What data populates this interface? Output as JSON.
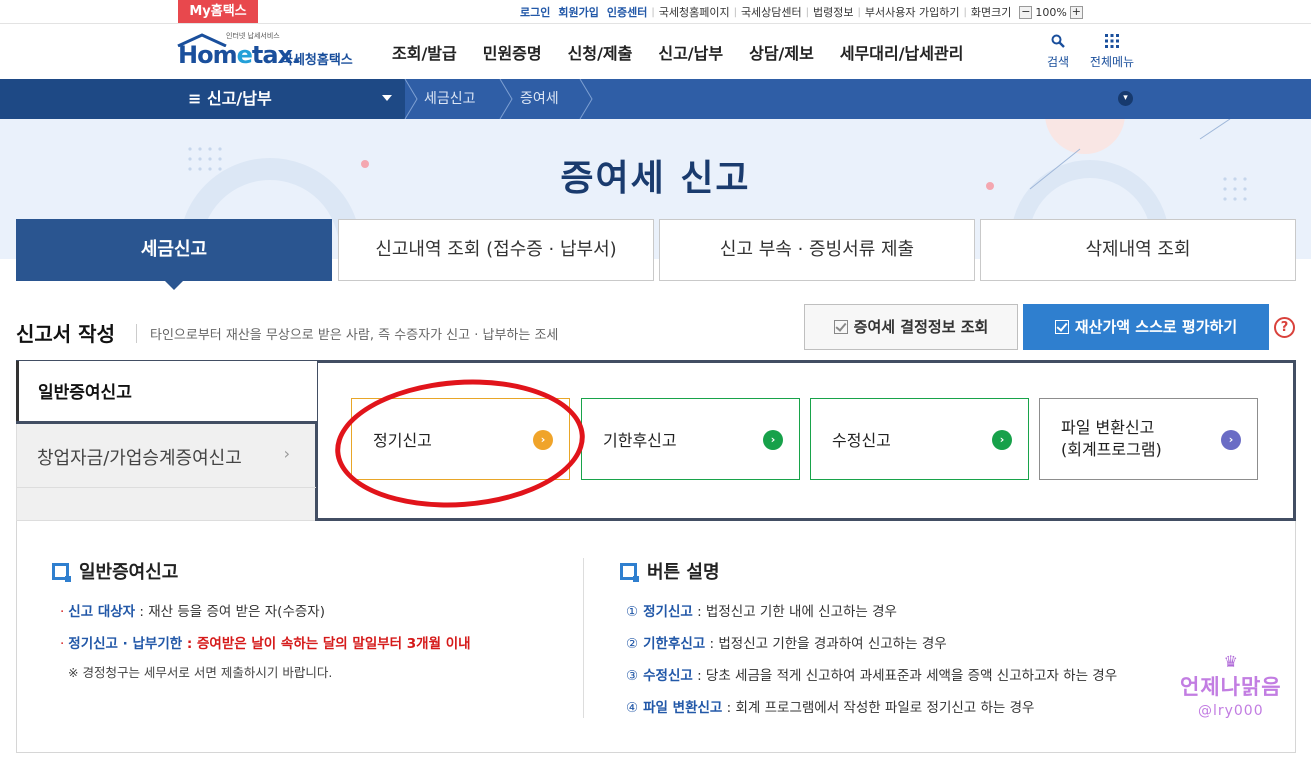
{
  "topbar": {
    "my_hometax": "My홈택스",
    "links": [
      "로그인",
      "회원가입",
      "인증센터",
      "국세청홈페이지",
      "국세상담센터",
      "법령정보",
      "부서사용자 가입하기",
      "화면크기"
    ],
    "zoom": "100%",
    "zoom_minus": "−",
    "zoom_plus": "+"
  },
  "header": {
    "logo_sub": "인터넷 납세서비스",
    "logo_main_pre": "Hom",
    "logo_main_e": "e",
    "logo_main_post": "tax.",
    "logo_kr": "국세청홈택스",
    "menu": [
      "조회/발급",
      "민원증명",
      "신청/제출",
      "신고/납부",
      "상담/제보",
      "세무대리/납세관리"
    ],
    "search_label": "검색",
    "allmenu_label": "전체메뉴"
  },
  "breadcrumb": {
    "menu_label": "신고/납부",
    "items": [
      "세금신고",
      "증여세"
    ]
  },
  "hero": {
    "title": "증여세 신고"
  },
  "tabs": [
    "세금신고",
    "신고내역 조회 (접수증 · 납부서)",
    "신고 부속 · 증빙서류 제출",
    "삭제내역 조회"
  ],
  "section": {
    "title": "신고서 작성",
    "desc": "타인으로부터 재산을 무상으로 받은 사람, 즉 수증자가 신고 · 납부하는 조세",
    "btn_lookup": "증여세 결정정보 조회",
    "btn_eval": "재산가액 스스로 평가하기",
    "help": "?"
  },
  "form": {
    "nav": [
      "일반증여신고",
      "창업자금/가업승계증여신고"
    ],
    "cards": [
      {
        "label": "정기신고"
      },
      {
        "label": "기한후신고"
      },
      {
        "label": "수정신고"
      },
      {
        "label_line1": "파일 변환신고",
        "label_line2": "(회계프로그램)"
      }
    ]
  },
  "info_left": {
    "title": "일반증여신고",
    "l1_key": "신고 대상자",
    "l1_val": " : 재산 등을 증여 받은 자(수증자)",
    "l2_key": "정기신고 · 납부기한",
    "l2_val": " : 증여받은 날이 속하는 달의 말일부터 3개월 이내",
    "note": "※ 경정청구는 세무서로 서면 제출하시기 바랍니다."
  },
  "info_right": {
    "title": "버튼 설명",
    "items": [
      {
        "num": "①",
        "key": "정기신고",
        "val": " : 법정신고 기한 내에 신고하는 경우"
      },
      {
        "num": "②",
        "key": "기한후신고",
        "val": " : 법정신고 기한을 경과하여 신고하는 경우"
      },
      {
        "num": "③",
        "key": "수정신고",
        "val": " : 당초 세금을 적게 신고하여 과세표준과 세액을 증액 신고하고자 하는 경우"
      },
      {
        "num": "④",
        "key": "파일 변환신고",
        "val": " : 회계 프로그램에서 작성한 파일로 정기신고 하는 경우"
      }
    ]
  },
  "watermark": {
    "line1": "언제나맑음",
    "line2": "@lry000"
  },
  "colors": {
    "brand": "#2f5ea6",
    "accent": "#2f7fcf",
    "active_tab": "#2a5590",
    "alert_red": "#d51a1a",
    "highlight_circle": "#e1141b"
  }
}
